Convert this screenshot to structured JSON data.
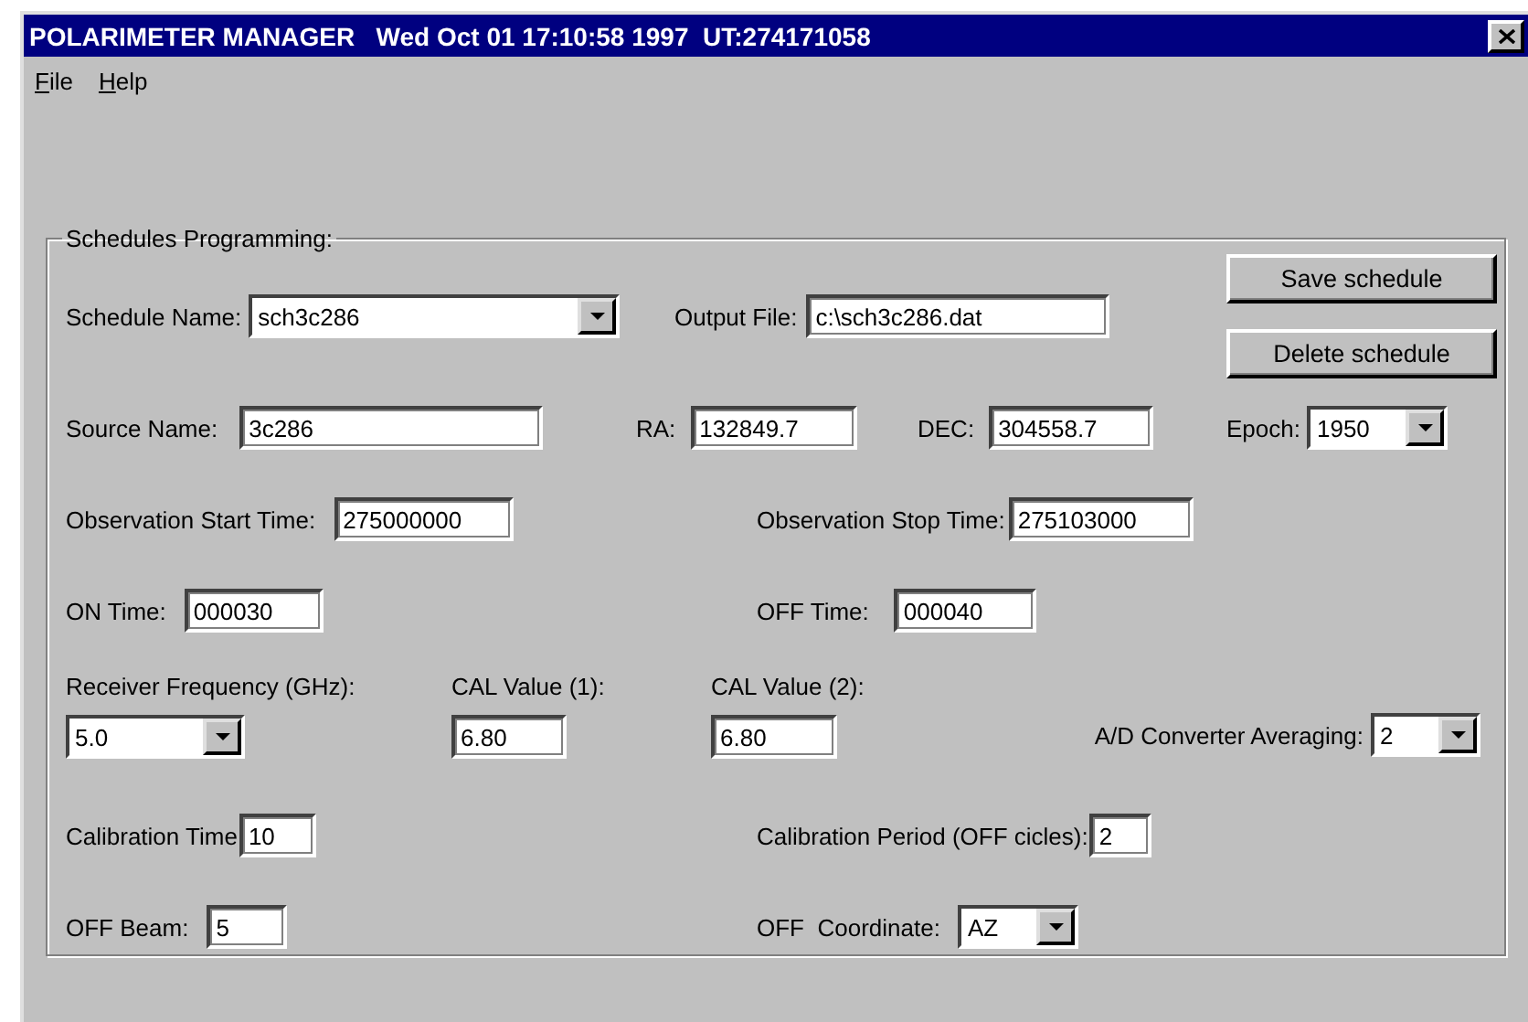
{
  "window": {
    "title": "POLARIMETER MANAGER   Wed Oct 01 17:10:58 1997  UT:274171058"
  },
  "menu": [
    {
      "label": "File"
    },
    {
      "label": "Help"
    }
  ],
  "group": {
    "title": "Schedules Programming:"
  },
  "buttons": [
    "Save schedule",
    "Delete schedule"
  ],
  "fields": [
    {
      "label": "Schedule Name:",
      "value": "sch3c286",
      "kind": "combo"
    },
    {
      "label": "Output File:",
      "value": "c:\\sch3c286.dat",
      "kind": "input"
    },
    {
      "label": "Source Name:",
      "value": "3c286",
      "kind": "input"
    },
    {
      "label": "RA:",
      "value": "132849.7",
      "kind": "input"
    },
    {
      "label": "DEC:",
      "value": "304558.7",
      "kind": "input"
    },
    {
      "label": "Epoch:",
      "value": "1950",
      "kind": "combo"
    },
    {
      "label": "Observation Start Time:",
      "value": "275000000",
      "kind": "input"
    },
    {
      "label": "Observation Stop Time:",
      "value": "275103000",
      "kind": "input"
    },
    {
      "label": "ON Time:",
      "value": "000030",
      "kind": "input"
    },
    {
      "label": "OFF Time:",
      "value": "000040",
      "kind": "input"
    },
    {
      "label": "Receiver Frequency (GHz):",
      "value": "5.0",
      "kind": "combo"
    },
    {
      "label": "CAL Value (1):",
      "value": "6.80",
      "kind": "input"
    },
    {
      "label": "CAL Value (2):",
      "value": "6.80",
      "kind": "input"
    },
    {
      "label": "A/D Converter Averaging:",
      "value": "2",
      "kind": "combo"
    },
    {
      "label": "Calibration Time",
      "value": "10",
      "kind": "input"
    },
    {
      "label": "Calibration Period (OFF cicles):",
      "value": "2",
      "kind": "input"
    },
    {
      "label": "OFF Beam:",
      "value": "5",
      "kind": "input"
    },
    {
      "label": "OFF  Coordinate:",
      "value": "AZ",
      "kind": "combo"
    }
  ]
}
